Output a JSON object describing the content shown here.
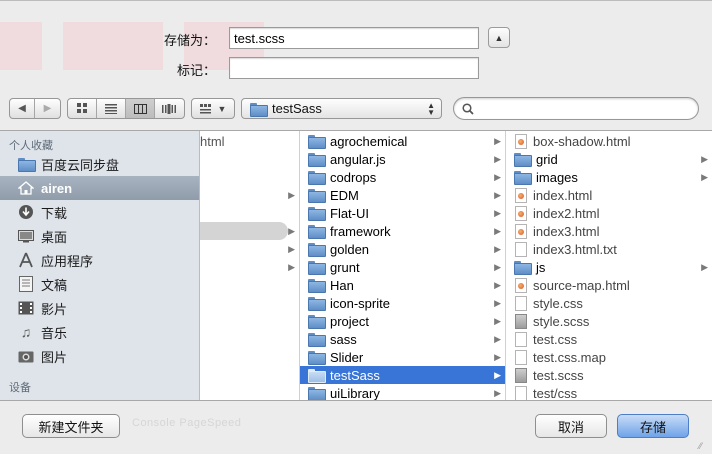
{
  "form": {
    "saveas_label": "存储为：",
    "filename": "test.scss",
    "tags_label": "标记：",
    "tags_value": ""
  },
  "toolbar": {
    "back_glyph": "◀",
    "forward_glyph": "▶",
    "path_label": "testSass",
    "search_value": ""
  },
  "sidebar": {
    "favorites_header": "个人收藏",
    "devices_header": "设备",
    "items": [
      {
        "label": "百度云同步盘",
        "icon": "folder-icon"
      },
      {
        "label": "airen",
        "icon": "home-icon",
        "selected": true
      },
      {
        "label": "下载",
        "icon": "download-icon"
      },
      {
        "label": "桌面",
        "icon": "desktop-icon"
      },
      {
        "label": "应用程序",
        "icon": "applications-icon"
      },
      {
        "label": "文稿",
        "icon": "documents-icon"
      },
      {
        "label": "影片",
        "icon": "movies-icon"
      },
      {
        "label": "音乐",
        "icon": "music-icon"
      },
      {
        "label": "图片",
        "icon": "pictures-icon"
      }
    ]
  },
  "columns": {
    "col0": [
      {
        "name": "html"
      }
    ],
    "col1": [
      {
        "name": "agrochemical",
        "type": "folder"
      },
      {
        "name": "angular.js",
        "type": "folder"
      },
      {
        "name": "codrops",
        "type": "folder"
      },
      {
        "name": "EDM",
        "type": "folder"
      },
      {
        "name": "Flat-UI",
        "type": "folder"
      },
      {
        "name": "framework",
        "type": "folder"
      },
      {
        "name": "golden",
        "type": "folder"
      },
      {
        "name": "grunt",
        "type": "folder"
      },
      {
        "name": "Han",
        "type": "folder"
      },
      {
        "name": "icon-sprite",
        "type": "folder"
      },
      {
        "name": "project",
        "type": "folder"
      },
      {
        "name": "sass",
        "type": "folder"
      },
      {
        "name": "Slider",
        "type": "folder"
      },
      {
        "name": "testSass",
        "type": "folder",
        "selected": true
      },
      {
        "name": "uiLibrary",
        "type": "folder"
      }
    ],
    "col2": [
      {
        "name": "box-shadow.html",
        "type": "html"
      },
      {
        "name": "grid",
        "type": "folder"
      },
      {
        "name": "images",
        "type": "folder"
      },
      {
        "name": "index.html",
        "type": "html"
      },
      {
        "name": "index2.html",
        "type": "html"
      },
      {
        "name": "index3.html",
        "type": "html"
      },
      {
        "name": "index3.html.txt",
        "type": "file"
      },
      {
        "name": "js",
        "type": "folder"
      },
      {
        "name": "source-map.html",
        "type": "html"
      },
      {
        "name": "style.css",
        "type": "file"
      },
      {
        "name": "style.scss",
        "type": "scss"
      },
      {
        "name": "test.css",
        "type": "file"
      },
      {
        "name": "test.css.map",
        "type": "file"
      },
      {
        "name": "test.scss",
        "type": "scss"
      },
      {
        "name": "test/css",
        "type": "file"
      }
    ]
  },
  "bottom": {
    "ghost_text": "Console   PageSpeed",
    "new_folder_label": "新建文件夹",
    "cancel_label": "取消",
    "save_label": "存储"
  }
}
